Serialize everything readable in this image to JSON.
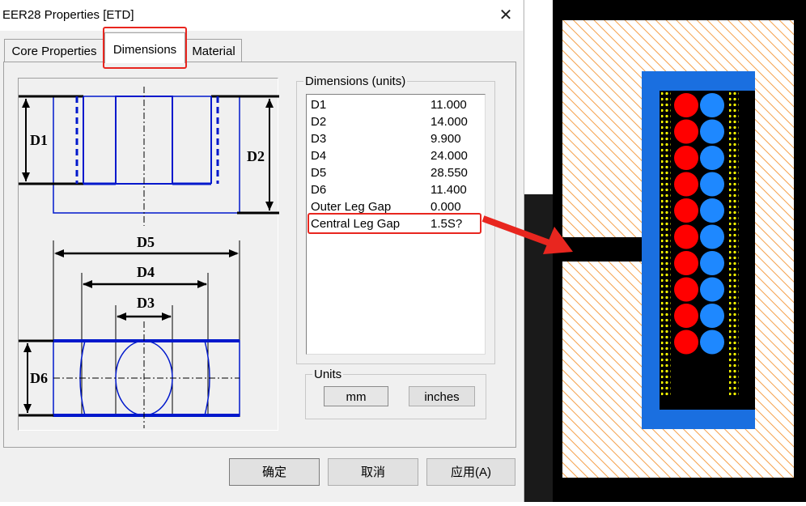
{
  "window": {
    "title": "EER28 Properties [ETD]",
    "close_glyph": "✕"
  },
  "tabs": [
    {
      "label": "Core Properties"
    },
    {
      "label": "Dimensions"
    },
    {
      "label": "Material"
    }
  ],
  "drawing_labels": {
    "d1": "D1",
    "d2": "D2",
    "d3": "D3",
    "d4": "D4",
    "d5": "D5",
    "d6": "D6"
  },
  "dimensions": {
    "group_title": "Dimensions (units)",
    "rows": [
      {
        "name": "D1",
        "value": "11.000"
      },
      {
        "name": "D2",
        "value": "14.000"
      },
      {
        "name": "D3",
        "value": "9.900"
      },
      {
        "name": "D4",
        "value": "24.000"
      },
      {
        "name": "D5",
        "value": "28.550"
      },
      {
        "name": "D6",
        "value": "11.400"
      },
      {
        "name": "Outer Leg Gap",
        "value": "0.000"
      },
      {
        "name": "Central Leg Gap",
        "value": "1.5S?"
      }
    ]
  },
  "units": {
    "group_title": "Units",
    "mm_label": "mm",
    "inches_label": "inches",
    "selected": "mm"
  },
  "footer": {
    "ok_label": "确定",
    "cancel_label": "取消",
    "apply_label": "应用(A)"
  },
  "colors": {
    "highlight": "#e8261f",
    "core_blue": "#1a6fe0",
    "winding_red": "#ff0000",
    "winding_blue": "#1e88ff",
    "hatch": "#f5a04a",
    "insulation_dots": "#ffff00"
  }
}
